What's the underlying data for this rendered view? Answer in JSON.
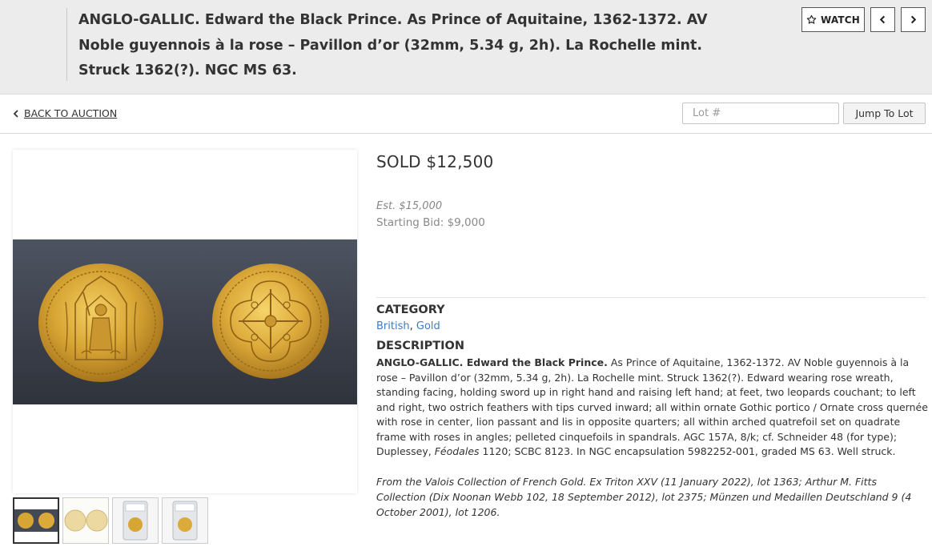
{
  "header": {
    "title": "ANGLO-GALLIC. Edward the Black Prince. As Prince of Aquitaine, 1362-1372. AV Noble guyennois à la rose – Pavillon d’or (32mm, 5.34 g, 2h). La Rochelle mint. Struck 1362(?). NGC MS 63.",
    "watch_label": "WATCH",
    "watch_icon": "star-outline-icon",
    "prev_icon": "chevron-left-icon",
    "next_icon": "chevron-right-icon"
  },
  "toolbar": {
    "back_label": "BACK TO AUCTION",
    "lot_placeholder": "Lot #",
    "jump_label": "Jump To Lot"
  },
  "lot": {
    "sold_price": "SOLD $12,500",
    "estimate": "Est. $15,000",
    "starting_bid": "Starting Bid: $9,000",
    "category_heading": "CATEGORY",
    "categories": [
      "British",
      "Gold"
    ],
    "category_separator": ", ",
    "description_heading": "DESCRIPTION",
    "description_lead": "ANGLO-GALLIC. Edward the Black Prince.",
    "description_body": " As Prince of Aquitaine, 1362-1372. AV Noble guyennois à la rose – Pavillon d’or (32mm, 5.34 g, 2h). La Rochelle mint. Struck 1362(?). Edward wearing rose wreath, standing facing, holding sword up in right hand and raising left hand; at feet, two leopards couchant; to left and right, two ostrich feathers with tips curved inward; all within ornate Gothic portico / Ornate cross quernée with rose in center, lion passant and lis in opposite quarters; all within arched quatrefoil set on quadrate frame with roses in angles; pelleted cinquefoils in spandrals. AGC 157A, 8/k; cf. Schneider 48 (for type); Duplessey, ",
    "description_italic": "Féodales",
    "description_tail": " 1120; SCBC 8123. In NGC encapsulation 5982252-001, graded MS 63. Well struck.",
    "provenance": "From the Valois Collection of French Gold. Ex Triton XXV (11 January 2022), lot 1363; Arthur M. Fitts Collection (Dix Noonan Webb 102, 18 September 2012), lot 2375; Münzen und Medaillen Deutschland 9 (4 October 2001), lot 1206."
  },
  "colors": {
    "header_bg": "#ececec",
    "link": "#3b7dc4",
    "gold": "#d9a83a",
    "photo_bg": "#444a55"
  }
}
